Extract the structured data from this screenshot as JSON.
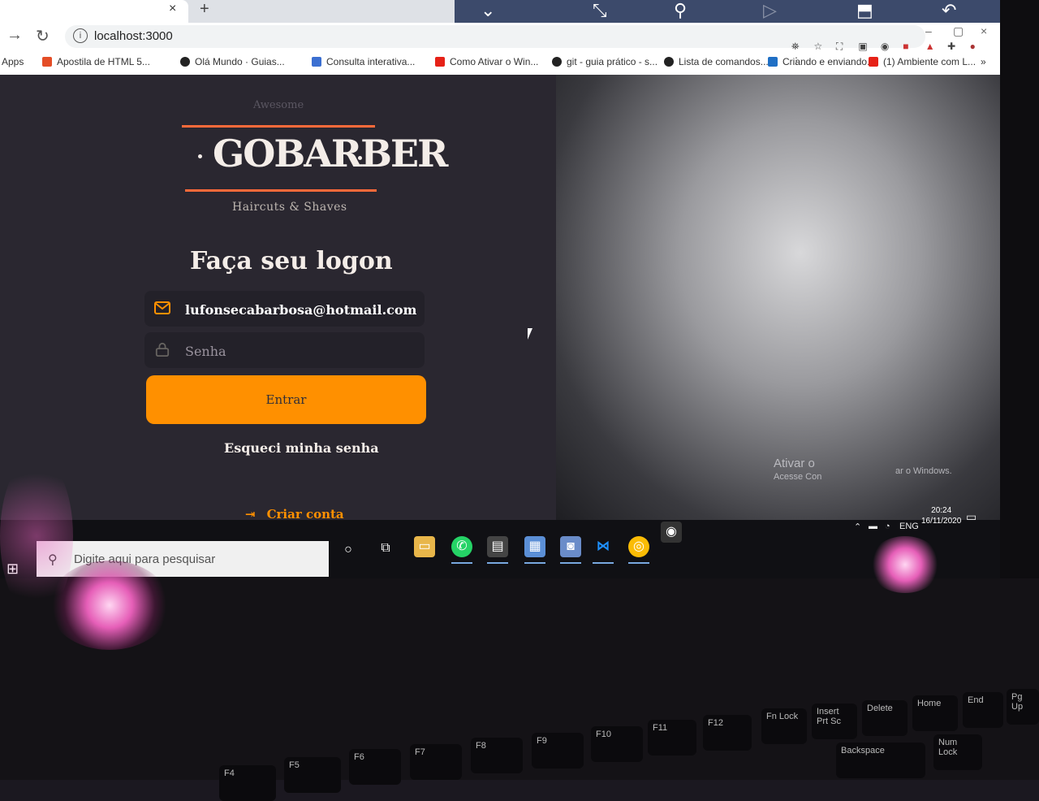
{
  "browser": {
    "new_tab": "+",
    "tab_close": "×",
    "url": "localhost:3000",
    "window_min": "–",
    "window_restore": "▢",
    "window_close": "×",
    "bookmarks": [
      {
        "label": "Apps"
      },
      {
        "label": "Apostila de HTML 5..."
      },
      {
        "label": "Olá Mundo · Guias..."
      },
      {
        "label": "Consulta interativa..."
      },
      {
        "label": "Como Ativar o Win..."
      },
      {
        "label": "git - guia prático - s..."
      },
      {
        "label": "Lista de comandos..."
      },
      {
        "label": "Criando e enviando..."
      },
      {
        "label": "(1) Ambiente com L..."
      }
    ],
    "bookmarks_more": "»"
  },
  "brand": {
    "top_text": "Awesome",
    "name": "GOBARBER",
    "tagline": "Haircuts & Shaves",
    "accent": "#ff9000",
    "line_color": "#ff6a3a"
  },
  "login": {
    "title": "Faça seu logon",
    "email_value": "lufonsecabarbosa@hotmail.com",
    "password_placeholder": "Senha",
    "submit_label": "Entrar",
    "forgot_label": "Esqueci minha senha",
    "create_label": "Criar conta"
  },
  "watermark": {
    "line1": "Ativar o",
    "line2": "Acesse Con",
    "line3": "ar o Windows."
  },
  "taskbar": {
    "search_placeholder": "Digite aqui para pesquisar",
    "language": "ENG",
    "time": "20:24",
    "date": "16/11/2020"
  },
  "keyboard": {
    "keys": [
      "F4",
      "F5",
      "F6",
      "F7",
      "F8",
      "F9",
      "F10",
      "F11",
      "F12",
      "Fn Lock",
      "Insert Prt Sc",
      "Delete",
      "Home",
      "End",
      "Pg Up",
      "Backspace",
      "Num Lock"
    ]
  }
}
